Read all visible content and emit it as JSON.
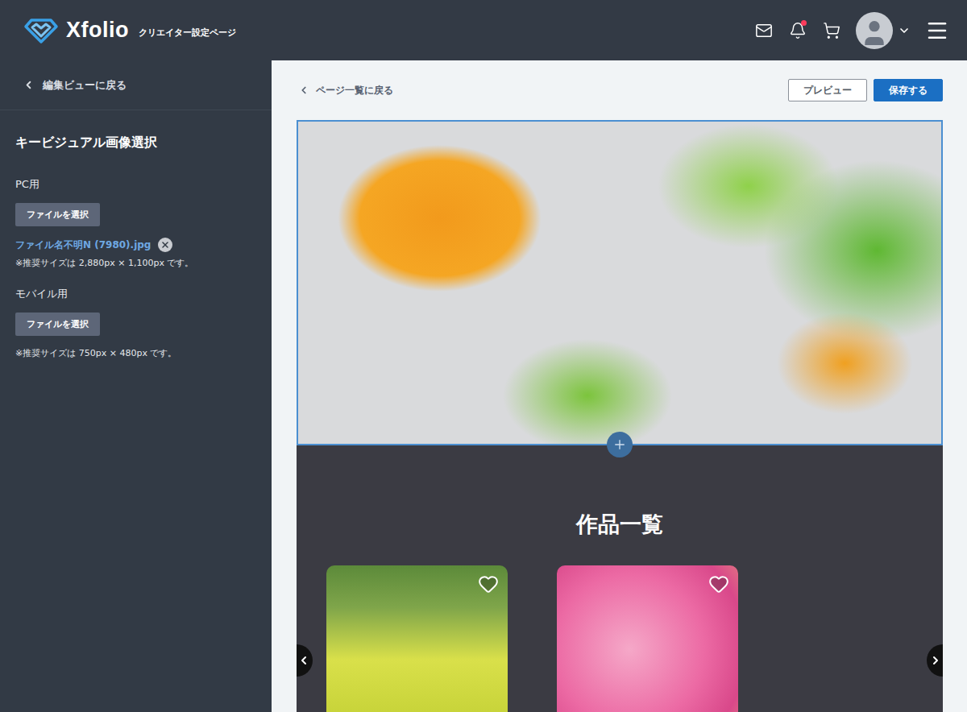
{
  "header": {
    "logo": "Xfolio",
    "subtitle": "クリエイター設定ページ",
    "notification_unread": true
  },
  "sidebar": {
    "back": "編集ビューに戻る",
    "title": "キービジュアル画像選択",
    "sections": [
      {
        "label": "PC用",
        "button": "ファイルを選択",
        "file": "ファイル名不明N (7980).jpg",
        "note": "※推奨サイズは 2,880px × 1,100px です。"
      },
      {
        "label": "モバイル用",
        "button": "ファイルを選択",
        "note": "※推奨サイズは 750px × 480px です。"
      }
    ]
  },
  "toolbar": {
    "back": "ページ一覧に戻る",
    "preview": "プレビュー",
    "save": "保存する"
  },
  "key_visual": {
    "selected": true
  },
  "works": {
    "title": "作品一覧",
    "items": [
      {
        "liked": false
      },
      {
        "liked": false
      }
    ]
  }
}
